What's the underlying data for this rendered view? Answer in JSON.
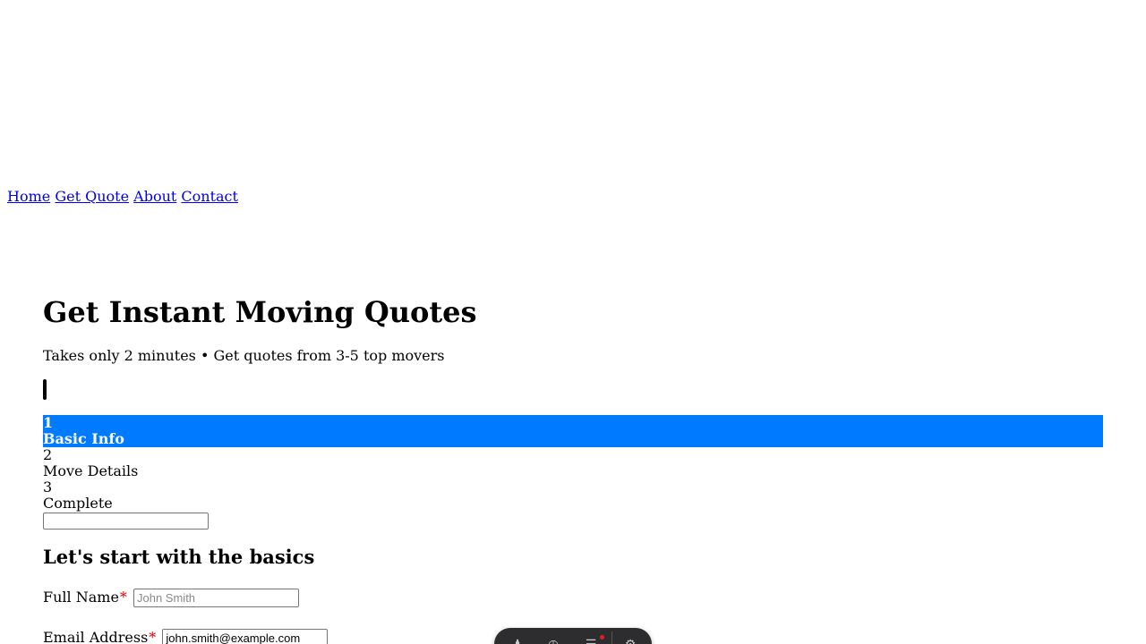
{
  "nav": {
    "links": [
      "Home",
      "Get Quote",
      "About",
      "Contact"
    ]
  },
  "hero": {
    "title": "Get Instant Moving Quotes",
    "subtitle": "Takes only 2 minutes • Get quotes from 3-5 top movers"
  },
  "progress": {
    "value_percent": 0.3
  },
  "steps": [
    {
      "number": "1",
      "label": "Basic Info",
      "active": true
    },
    {
      "number": "2",
      "label": "Move Details",
      "active": false
    },
    {
      "number": "3",
      "label": "Complete",
      "active": false
    }
  ],
  "step_input": {
    "value": ""
  },
  "form": {
    "heading": "Let's start with the basics",
    "required_marker": "*",
    "full_name": {
      "label": "Full Name",
      "placeholder": "John Smith",
      "value": ""
    },
    "email": {
      "label": "Email Address",
      "placeholder": "",
      "value": "john.smith@example.com"
    }
  },
  "toolbar": {
    "icons": [
      "person-icon",
      "clock-icon",
      "list-icon",
      "gear-icon"
    ]
  },
  "colors": {
    "active_step": "#007bff",
    "link": "#0000ee",
    "required": "#e00000",
    "toolbar": "#2d2d30"
  }
}
